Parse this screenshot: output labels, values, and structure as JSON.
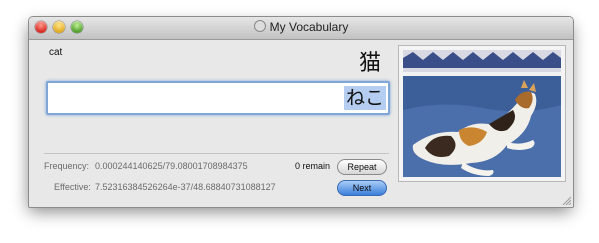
{
  "window": {
    "title": "My Vocabulary"
  },
  "card": {
    "english": "cat",
    "kanji": "猫",
    "answer_value": "",
    "kana": "ねこ"
  },
  "stats": {
    "frequency_label": "Frequency:",
    "frequency_value": "0.000244140625/79.08001708984375",
    "effective_label": "Effective:",
    "effective_value": "7.52316384526264e-37/48.68840731088127",
    "remaining": "0 remain"
  },
  "buttons": {
    "repeat": "Repeat",
    "next": "Next"
  },
  "colors": {
    "accent": "#7fa6d6",
    "next_button": "#3b7fdb",
    "kana_highlight": "#b4cdf1"
  }
}
